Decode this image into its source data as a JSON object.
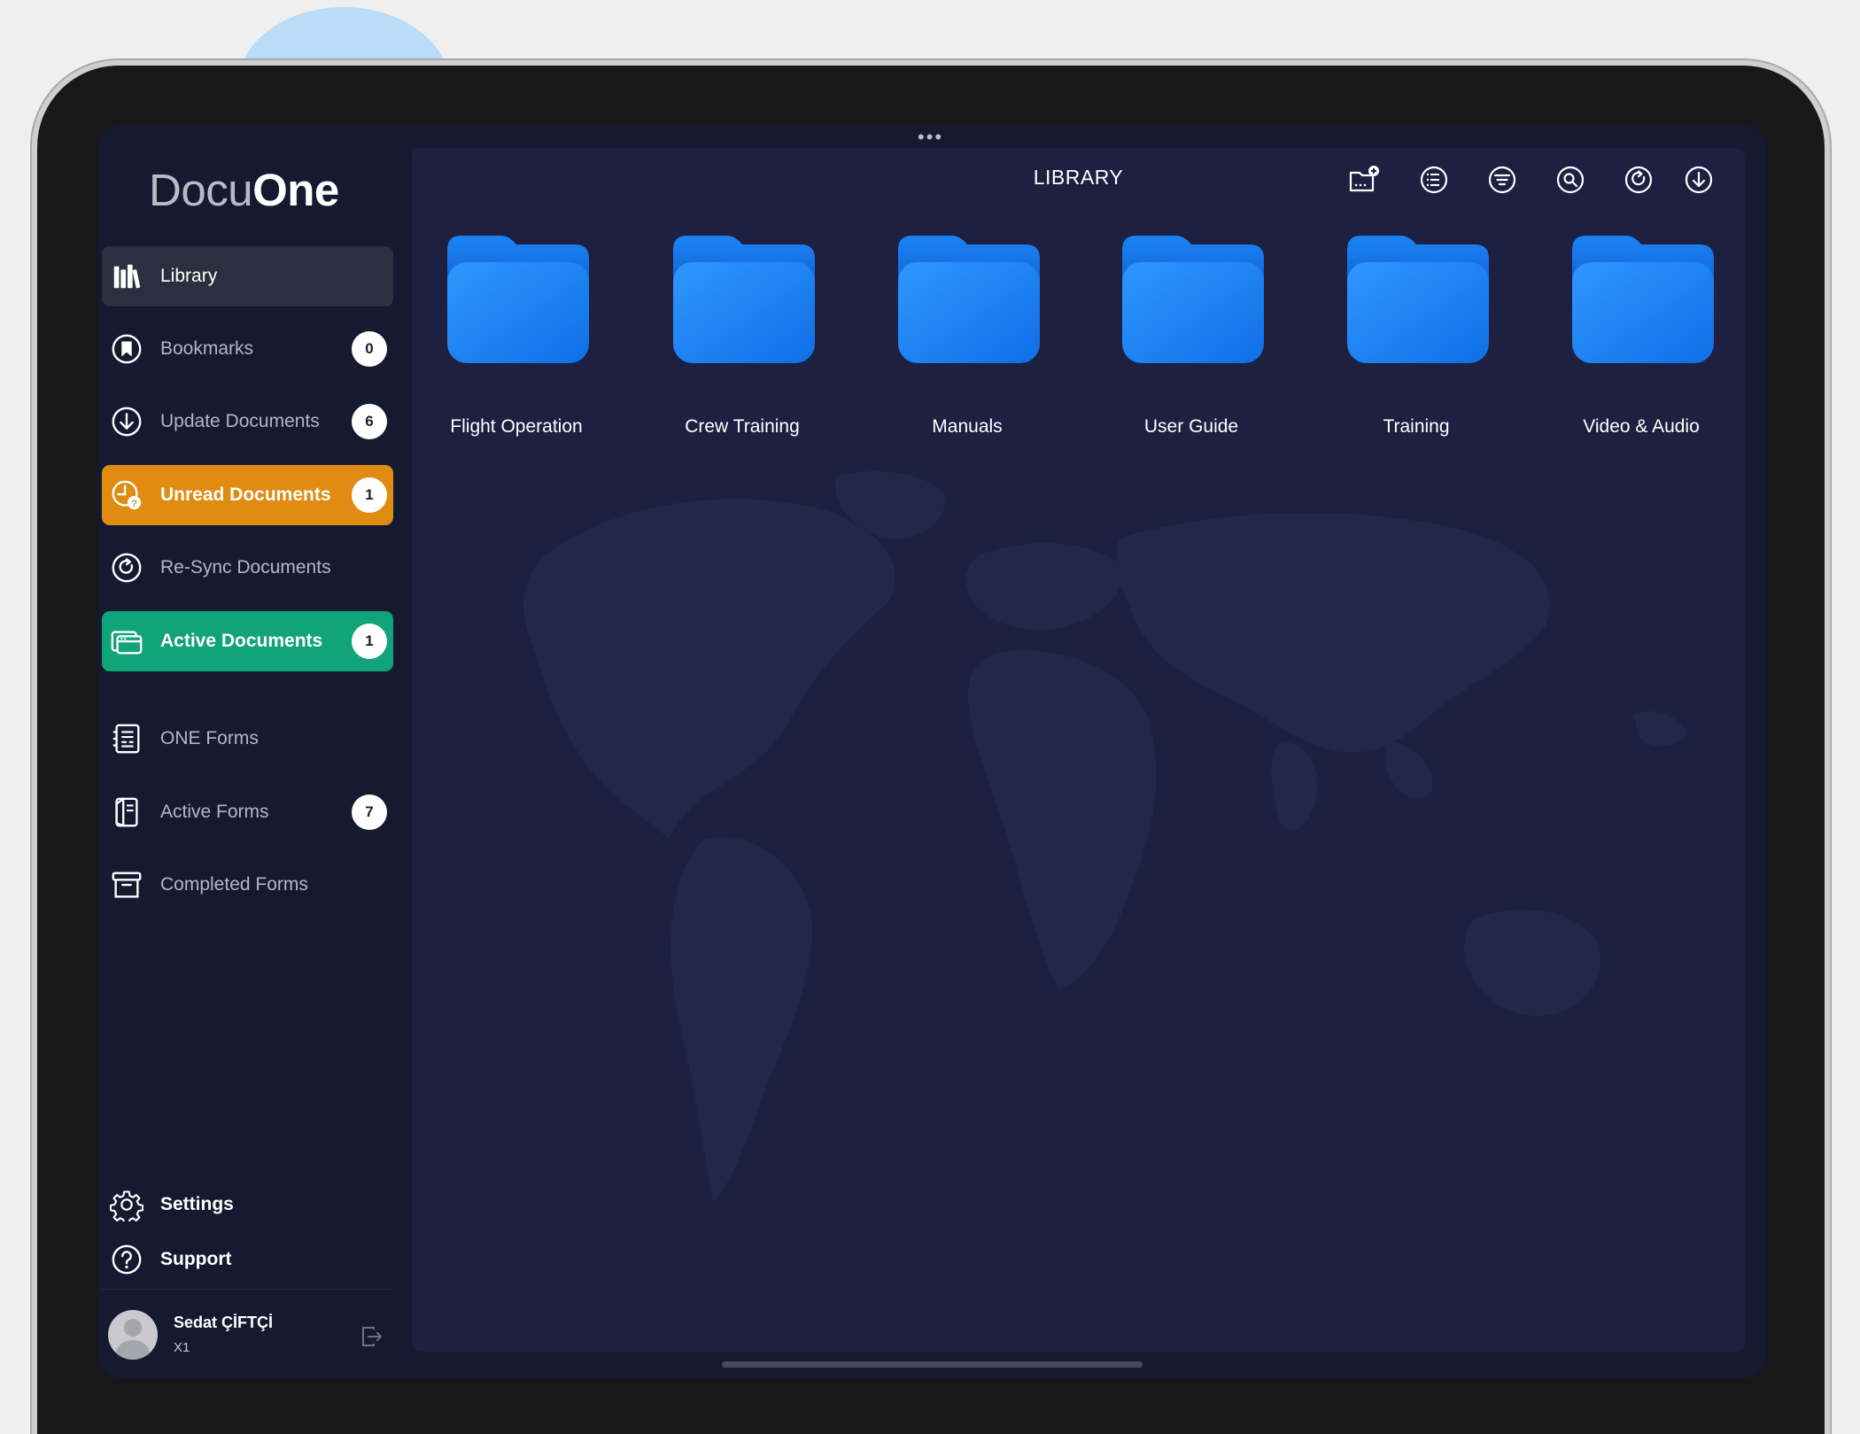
{
  "app": {
    "logo_part1": "Docu",
    "logo_part2": "One"
  },
  "sidebar": {
    "items": [
      {
        "label": "Library",
        "icon": "library-icon",
        "badge": null,
        "state": "selected"
      },
      {
        "label": "Bookmarks",
        "icon": "bookmark-icon",
        "badge": "0"
      },
      {
        "label": "Update Documents",
        "icon": "download-icon",
        "badge": "6"
      },
      {
        "label": "Unread Documents",
        "icon": "clock-question-icon",
        "badge": "1",
        "color": "#e08c13"
      },
      {
        "label": "Re-Sync Documents",
        "icon": "resync-icon",
        "badge": null
      },
      {
        "label": "Active Documents",
        "icon": "stacked-windows-icon",
        "badge": "1",
        "color": "#11a37a"
      },
      {
        "label": "ONE Forms",
        "icon": "forms-icon",
        "badge": null
      },
      {
        "label": "Active Forms",
        "icon": "active-form-icon",
        "badge": "7"
      },
      {
        "label": "Completed Forms",
        "icon": "archive-box-icon",
        "badge": null
      }
    ],
    "bottom": [
      {
        "label": "Settings",
        "icon": "gear-icon"
      },
      {
        "label": "Support",
        "icon": "question-circle-icon"
      }
    ],
    "user": {
      "name": "Sedat ÇİFTÇİ",
      "subtitle": "X1"
    }
  },
  "main": {
    "title": "LIBRARY",
    "toolbar": [
      {
        "icon": "add-folder-icon"
      },
      {
        "icon": "list-view-icon"
      },
      {
        "icon": "filter-icon"
      },
      {
        "icon": "search-icon"
      },
      {
        "icon": "refresh-icon"
      },
      {
        "icon": "download-icon"
      }
    ],
    "folders": [
      {
        "label": "Flight Operation"
      },
      {
        "label": "Crew Training"
      },
      {
        "label": "Manuals"
      },
      {
        "label": "User Guide"
      },
      {
        "label": "Training"
      },
      {
        "label": "Video & Audio"
      }
    ]
  },
  "colors": {
    "screen_bg": "#161a30",
    "panel_bg": "#1d2040",
    "folder_blue": "#1a7cf0",
    "unread_orange": "#e08c13",
    "active_green": "#11a37a"
  }
}
